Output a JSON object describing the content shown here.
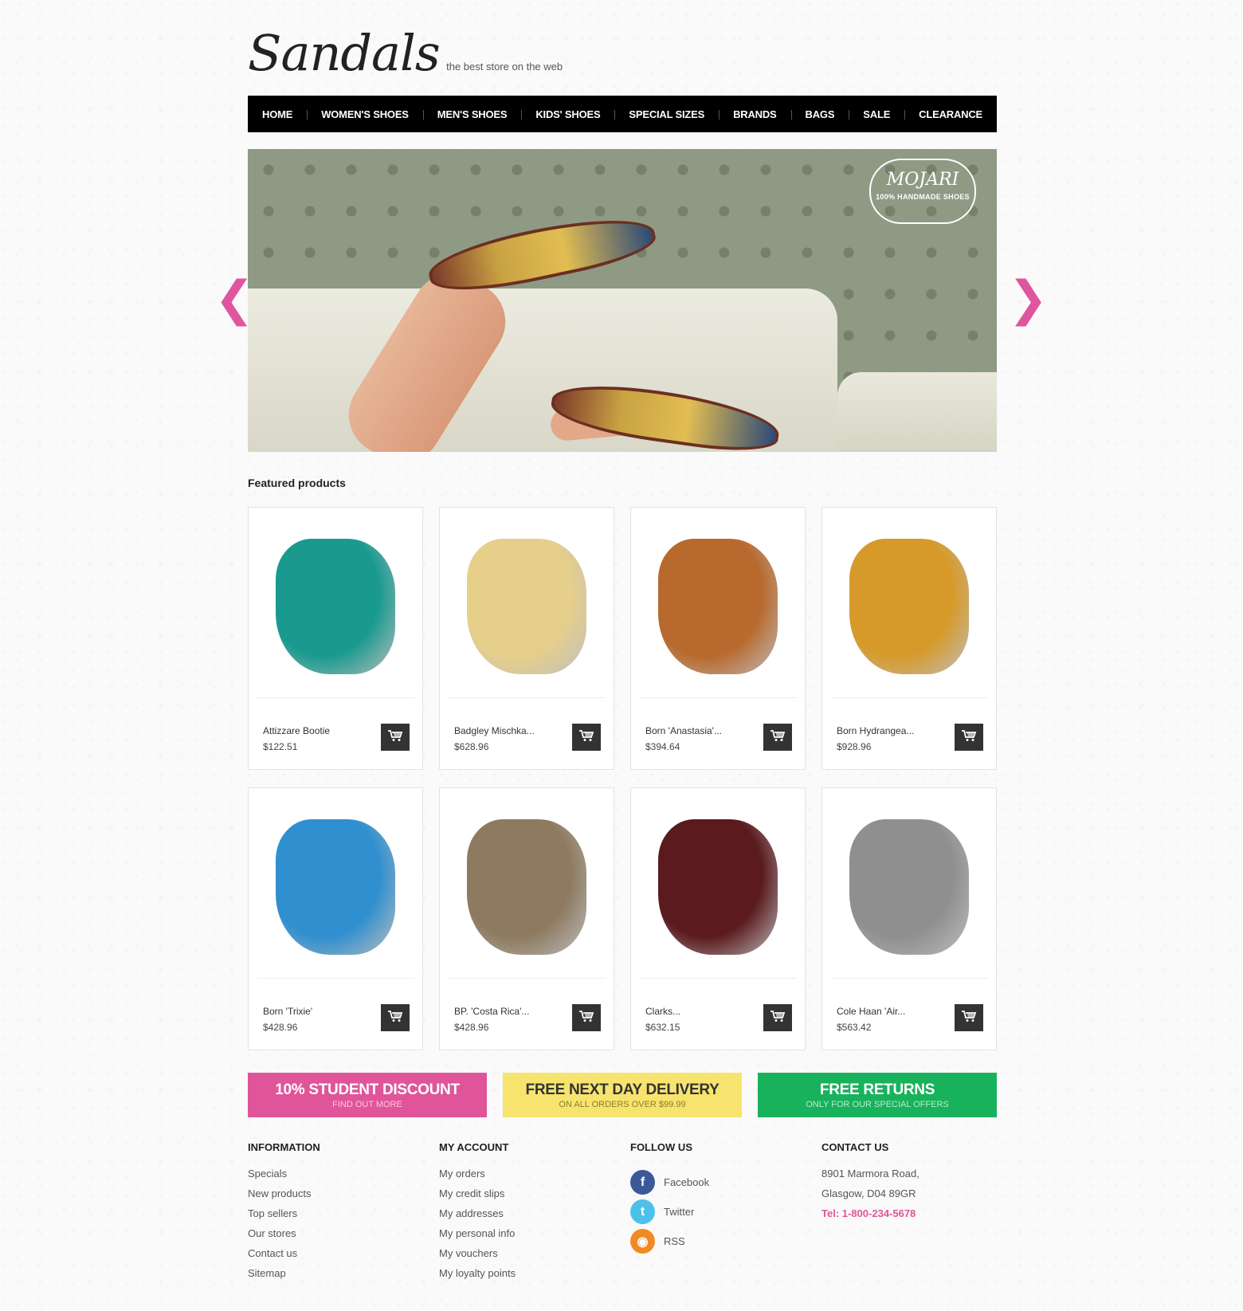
{
  "header": {
    "logo": "Sandals",
    "tagline": "the best store on the web"
  },
  "nav": {
    "items": [
      "HOME",
      "WOMEN'S SHOES",
      "MEN'S SHOES",
      "KIDS' SHOES",
      "SPECIAL SIZES",
      "BRANDS",
      "BAGS",
      "SALE",
      "CLEARANCE"
    ]
  },
  "slider": {
    "brand": "MOJARI",
    "brand_sub": "100% HANDMADE SHOES",
    "prev_arrow": "❮",
    "next_arrow": "❯"
  },
  "featured": {
    "title": "Featured products",
    "products": [
      {
        "name": "Attizzare Bootie",
        "price": "$122.51",
        "color": "#1a9a8f"
      },
      {
        "name": "Badgley Mischka...",
        "price": "$628.96",
        "color": "#e6cf8a"
      },
      {
        "name": "Born 'Anastasia'...",
        "price": "$394.64",
        "color": "#b8692d"
      },
      {
        "name": "Born Hydrangea...",
        "price": "$928.96",
        "color": "#d69a2a"
      },
      {
        "name": "Born 'Trixie'",
        "price": "$428.96",
        "color": "#2f8fcf"
      },
      {
        "name": "BP. 'Costa Rica'...",
        "price": "$428.96",
        "color": "#8d7a60"
      },
      {
        "name": "Clarks...",
        "price": "$632.15",
        "color": "#5a1a1e"
      },
      {
        "name": "Cole Haan 'Air...",
        "price": "$563.42",
        "color": "#8f8f8f"
      }
    ]
  },
  "promos": [
    {
      "title": "10% STUDENT DISCOUNT",
      "sub": "FIND OUT MORE"
    },
    {
      "title": "FREE NEXT DAY DELIVERY",
      "sub": "ON ALL ORDERS OVER $99.99"
    },
    {
      "title": "FREE RETURNS",
      "sub": "ONLY FOR OUR SPECIAL OFFERS"
    }
  ],
  "footer": {
    "information": {
      "title": "INFORMATION",
      "links": [
        "Specials",
        "New products",
        "Top sellers",
        "Our stores",
        "Contact us",
        "Sitemap"
      ]
    },
    "account": {
      "title": "MY ACCOUNT",
      "links": [
        "My orders",
        "My credit slips",
        "My addresses",
        "My personal info",
        "My vouchers",
        "My loyalty points"
      ]
    },
    "follow": {
      "title": "FOLLOW US",
      "items": [
        {
          "label": "Facebook",
          "icon": "facebook-icon",
          "glyph": "f"
        },
        {
          "label": "Twitter",
          "icon": "twitter-icon",
          "glyph": "t"
        },
        {
          "label": "RSS",
          "icon": "rss-icon",
          "glyph": "◉"
        }
      ]
    },
    "contact": {
      "title": "CONTACT US",
      "address1": "8901 Marmora Road,",
      "address2": "Glasgow, D04 89GR",
      "tel": "Tel: 1-800-234-5678"
    }
  },
  "colors": {
    "accent": "#e0559a",
    "nav_bg": "#000000",
    "yellow": "#f7e46e",
    "green": "#19b25c"
  }
}
